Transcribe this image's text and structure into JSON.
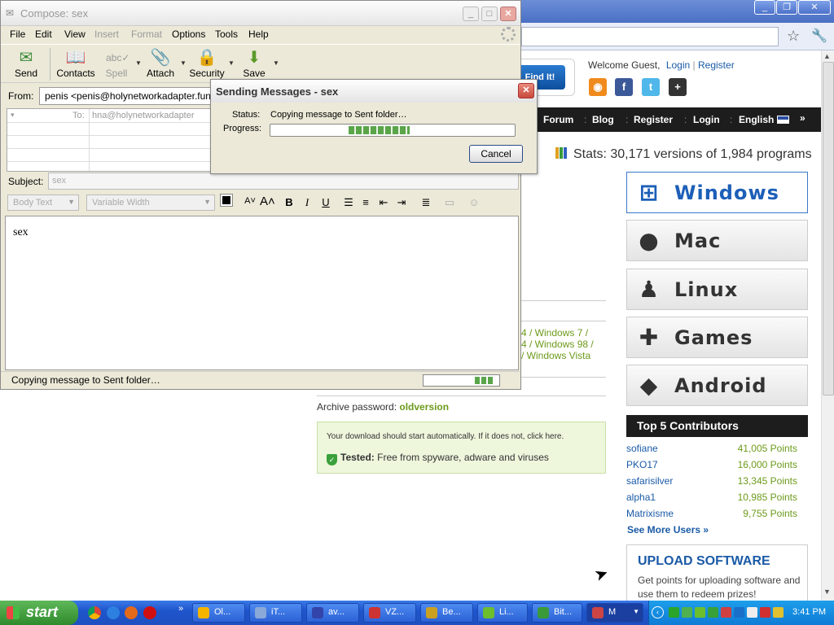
{
  "browser": {
    "find_button": "Find It!",
    "welcome_prefix": "Welcome Guest,",
    "login_link": "Login",
    "register_link": "Register",
    "nav": [
      "Forum",
      "Blog",
      "Register",
      "Login",
      "English"
    ],
    "stats": "Stats: 30,171 versions of 1,984 programs",
    "platforms": [
      "Windows",
      "Mac",
      "Linux",
      "Games",
      "Android"
    ],
    "compat_lines": [
      "4 / Windows 7 /",
      "4 / Windows 98 /",
      "/ Windows Vista"
    ],
    "archive_label": "Archive password:",
    "archive_value": "oldversion",
    "download_msg": "Your download should start automatically. If it does not, click here.",
    "tested_label": "Tested:",
    "tested_text": "Free from spyware, adware and viruses",
    "contributors_title": "Top 5 Contributors",
    "contributors": [
      {
        "name": "sofiane",
        "points": "41,005 Points"
      },
      {
        "name": "PKO17",
        "points": "16,000 Points"
      },
      {
        "name": "safarisilver",
        "points": "13,345 Points"
      },
      {
        "name": "alpha1",
        "points": "10,985 Points"
      },
      {
        "name": "Matrixisme",
        "points": "9,755 Points"
      }
    ],
    "see_more": "See More Users »",
    "upload_title": "UPLOAD SOFTWARE",
    "upload_desc": "Get points for uploading software and use them to redeem prizes!"
  },
  "compose": {
    "title": "Compose: sex",
    "menus": [
      "File",
      "Edit",
      "View",
      "Insert",
      "Format",
      "Options",
      "Tools",
      "Help"
    ],
    "toolbar": [
      "Send",
      "Contacts",
      "Spell",
      "Attach",
      "Security",
      "Save"
    ],
    "from_label": "From:",
    "from_value": "penis <penis@holynetworkadapter.fun>",
    "to_label": "To:",
    "to_value": "hna@holynetworkadapter",
    "subject_label": "Subject:",
    "subject_value": "sex",
    "body_style": "Body Text",
    "font": "Variable Width",
    "body_text": "sex",
    "status_text": "Copying message to Sent folder…"
  },
  "dialog": {
    "title": "Sending Messages - sex",
    "status_label": "Status:",
    "status_value": "Copying message to Sent folder…",
    "progress_label": "Progress:",
    "progress_fraction": 0.25,
    "cancel": "Cancel"
  },
  "taskbar": {
    "start": "start",
    "tasks": [
      "Ol...",
      "iT...",
      "av...",
      "VZ...",
      "Be...",
      "Li...",
      "Bit...",
      "M"
    ],
    "clock": "3:41 PM"
  },
  "colors": {
    "accent_blue": "#1a5aa6",
    "green_points": "#6c9a1a",
    "taskbar_blue": "#245edb"
  }
}
